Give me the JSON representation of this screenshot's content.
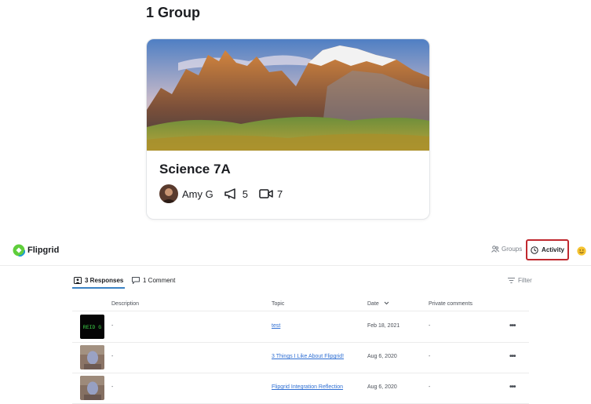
{
  "group_section": {
    "heading": "1 Group",
    "card": {
      "title": "Science 7A",
      "owner_name": "Amy G",
      "topics_count": "5",
      "videos_count": "7",
      "topics_icon": "megaphone-icon",
      "videos_icon": "video-camera-icon"
    }
  },
  "topbar": {
    "logo_text": "Flipgrid",
    "groups_label": "Groups",
    "activity_label": "Activity",
    "groups_icon": "people-icon",
    "activity_icon": "clock-icon",
    "emoji_icon": "smiley-icon",
    "highlight_color": "#c0292f"
  },
  "tabs": {
    "responses_label": "3 Responses",
    "comments_label": "1 Comment",
    "filter_label": "Filter"
  },
  "table": {
    "headers": {
      "description": "Description",
      "topic": "Topic",
      "date": "Date",
      "private_comments": "Private comments"
    },
    "rows": [
      {
        "thumb_text": "REID G",
        "description": "-",
        "topic": "test",
        "date": "Feb 18, 2021",
        "private_comments": "-",
        "more": "•••"
      },
      {
        "thumb_text": "",
        "description": "-",
        "topic": "3 Things I Like About Flipgrid!",
        "date": "Aug 6, 2020",
        "private_comments": "-",
        "more": "•••"
      },
      {
        "thumb_text": "",
        "description": "-",
        "topic": "Flipgrid Integration Reflection",
        "date": "Aug 6, 2020",
        "private_comments": "-",
        "more": "•••"
      }
    ]
  },
  "colors": {
    "accent_blue": "#3b82c4",
    "link_blue": "#2f6fd3",
    "brand_green": "#5fce3b"
  }
}
